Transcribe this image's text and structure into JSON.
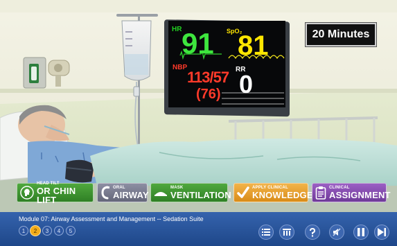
{
  "timer": {
    "label": "20 Minutes"
  },
  "monitor": {
    "hr_label": "HR",
    "hr_value": "91",
    "spo2_label": "SpO₂",
    "spo2_value": "81",
    "nbp_label": "NBP",
    "nbp_value": "113/57",
    "nbp_mean": "(76)",
    "rr_label": "RR",
    "rr_value": "0"
  },
  "actions": {
    "head_tilt": {
      "small": "HEAD TILT",
      "big": "OR CHIN LIFT",
      "color": "#3c9530"
    },
    "oral_airway": {
      "small": "ORAL",
      "big": "AIRWAY",
      "color": "#7a7c90"
    },
    "mask_ventilation": {
      "small": "MASK",
      "big": "VENTILATION",
      "color": "#3c9530"
    },
    "apply_knowledge": {
      "small": "APPLY CLINICAL",
      "big": "KNOWLEDGE",
      "color": "#e69d2b"
    },
    "clinical_assignment": {
      "small": "CLINICAL",
      "big": "ASSIGNMENT",
      "color": "#854aaf"
    }
  },
  "footer": {
    "module_title": "Module 07: Airway Assessment and Management -- Sedation Suite",
    "pages": [
      "1",
      "2",
      "3",
      "4",
      "5"
    ],
    "current_page": "2",
    "controls": [
      "menu-icon",
      "library-icon",
      "help-icon",
      "mute-icon",
      "pause-icon",
      "next-icon"
    ]
  }
}
